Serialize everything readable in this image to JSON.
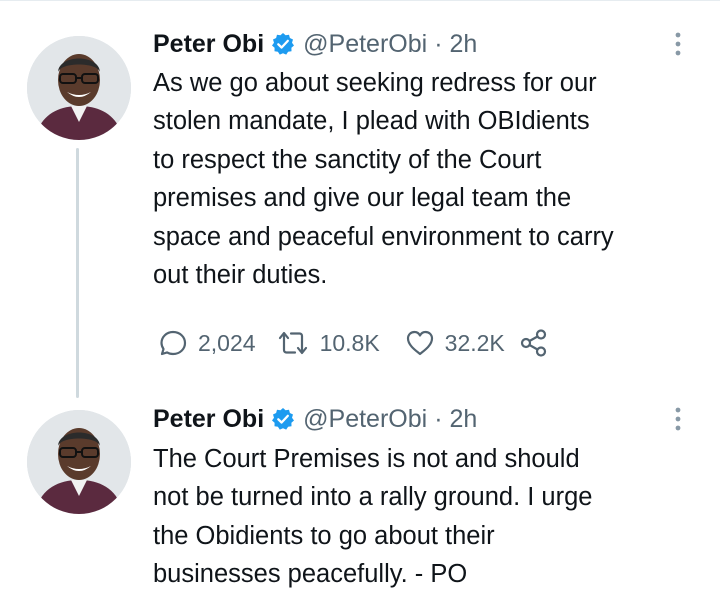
{
  "tweets": [
    {
      "author_name": "Peter Obi",
      "handle": "@PeterObi",
      "separator": "·",
      "time": "2h",
      "verified": true,
      "text": "As we go about seeking redress for our\nstolen mandate, I plead with OBIdients\nto respect the sanctity of the Court\npremises and give our legal team the\nspace and peaceful environment to carry\nout their duties.",
      "actions": {
        "replies": "2,024",
        "retweets": "10.8K",
        "likes": "32.2K"
      }
    },
    {
      "author_name": "Peter Obi",
      "handle": "@PeterObi",
      "separator": "·",
      "time": "2h",
      "verified": true,
      "text": "The Court Premises is not and should\nnot be turned into a rally ground. I urge\nthe Obidients to go about their\nbusinesses peacefully.  - PO"
    }
  ],
  "icons": {
    "verified": "verified-badge-icon",
    "more": "more-vertical-icon",
    "reply": "reply-icon",
    "retweet": "retweet-icon",
    "like": "heart-icon",
    "share": "share-icon"
  },
  "colors": {
    "text": "#0f1419",
    "secondary": "#536471",
    "verified_blue": "#1d9bf0",
    "thread_line": "#cfd9de"
  }
}
